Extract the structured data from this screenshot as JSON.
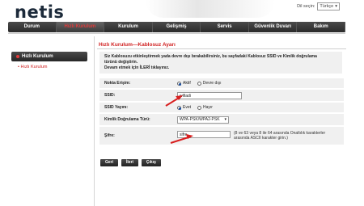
{
  "brand": {
    "name": "netis"
  },
  "language": {
    "label": "Dil seçin:",
    "selected": "Türkçe"
  },
  "nav": {
    "tabs": [
      {
        "label": "Durum",
        "active": false
      },
      {
        "label": "Hızlı Kurulum",
        "active": true
      },
      {
        "label": "Kurulum",
        "active": false
      },
      {
        "label": "Gelişmiş",
        "active": false
      },
      {
        "label": "Servis",
        "active": false
      },
      {
        "label": "Güvenlik Duvarı",
        "active": false
      },
      {
        "label": "Bakım",
        "active": false
      }
    ]
  },
  "sidebar": {
    "header": "Hızlı Kurulum",
    "items": [
      {
        "label": "• Hızlı Kurulum"
      }
    ]
  },
  "page": {
    "title": "Hızlı Kurulum—Kablosuz Ayarı",
    "intro_line1": "Siz Kablosuzu etkinleştirmek yada devre dışı bırakabilirsiniz, bu sayfadaki Kablosuz SSID ve Kimlik doğrulama",
    "intro_line2": "türünü değiştirin.",
    "intro_line3": "Devam etmek için İLERİ tıklayınız."
  },
  "form": {
    "access_point": {
      "label": "Nokta Erişim:",
      "option_on": "Aktif",
      "option_off": "Devre dışı",
      "selected": "Aktif"
    },
    "ssid": {
      "label": "SSID:",
      "value": "wifiadi"
    },
    "ssid_broadcast": {
      "label": "SSID Yayını:",
      "option_yes": "Evet",
      "option_no": "Hayır",
      "selected": "Evet"
    },
    "auth_type": {
      "label": "Kimlik Doğrulama Türü:",
      "selected": "WPA-PSK/WPA2-PSK"
    },
    "password": {
      "label": "Şifre:",
      "value": "sifre",
      "hint_line1": "(8 ve 63 veya 8 ile 64 arasında Onaltılık karakterler",
      "hint_line2": "arasında ASCII karakter girin.)"
    }
  },
  "buttons": {
    "back": "Geri",
    "next": "İleri",
    "exit": "Çıkış"
  },
  "colors": {
    "accent": "#d02020",
    "nav_bg": "#333333",
    "arrow": "#d81f1f"
  }
}
